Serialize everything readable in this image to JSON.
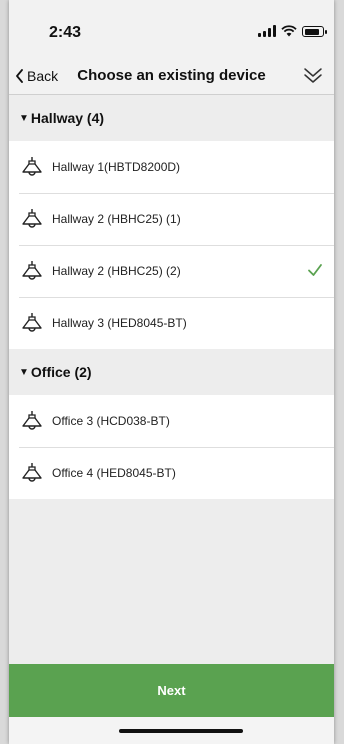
{
  "status_bar": {
    "time": "2:43"
  },
  "nav": {
    "back_label": "Back",
    "title": "Choose an existing device"
  },
  "groups": [
    {
      "header": "Hallway (4)",
      "devices": [
        {
          "label": "Hallway 1(HBTD8200D)",
          "selected": false
        },
        {
          "label": "Hallway 2 (HBHC25) (1)",
          "selected": false
        },
        {
          "label": "Hallway 2 (HBHC25) (2)",
          "selected": true
        },
        {
          "label": "Hallway 3 (HED8045-BT)",
          "selected": false
        }
      ]
    },
    {
      "header": "Office (2)",
      "devices": [
        {
          "label": "Office 3 (HCD038-BT)",
          "selected": false
        },
        {
          "label": "Office 4 (HED8045-BT)",
          "selected": false
        }
      ]
    }
  ],
  "footer": {
    "next_label": "Next"
  },
  "colors": {
    "accent": "#5aa250",
    "check": "#5aa250"
  },
  "icons": {
    "device": "lamp-icon",
    "selected": "checkmark-icon",
    "back": "chevron-left-icon",
    "collapse": "double-chevron-down-icon"
  }
}
